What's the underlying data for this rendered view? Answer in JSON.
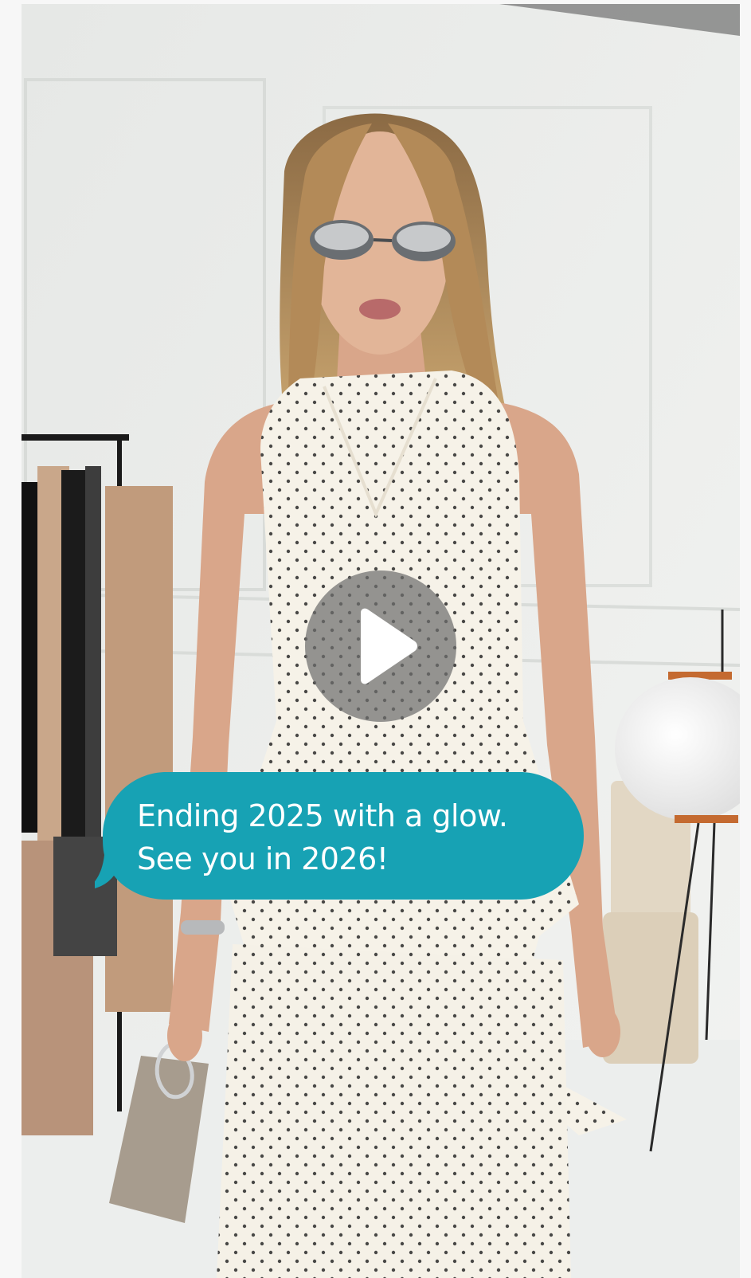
{
  "video": {
    "thumbnail_label": "",
    "play_icon": "play-icon"
  },
  "caption": {
    "line1": "Ending 2025 with a glow.",
    "line2": "See you in 2026!"
  },
  "colors": {
    "caption_bubble": "#17a2b4",
    "caption_text": "#ffffff",
    "play_overlay": "#6e6e6e",
    "dress": "#f6f2e8",
    "dots": "#2a2a2a"
  }
}
